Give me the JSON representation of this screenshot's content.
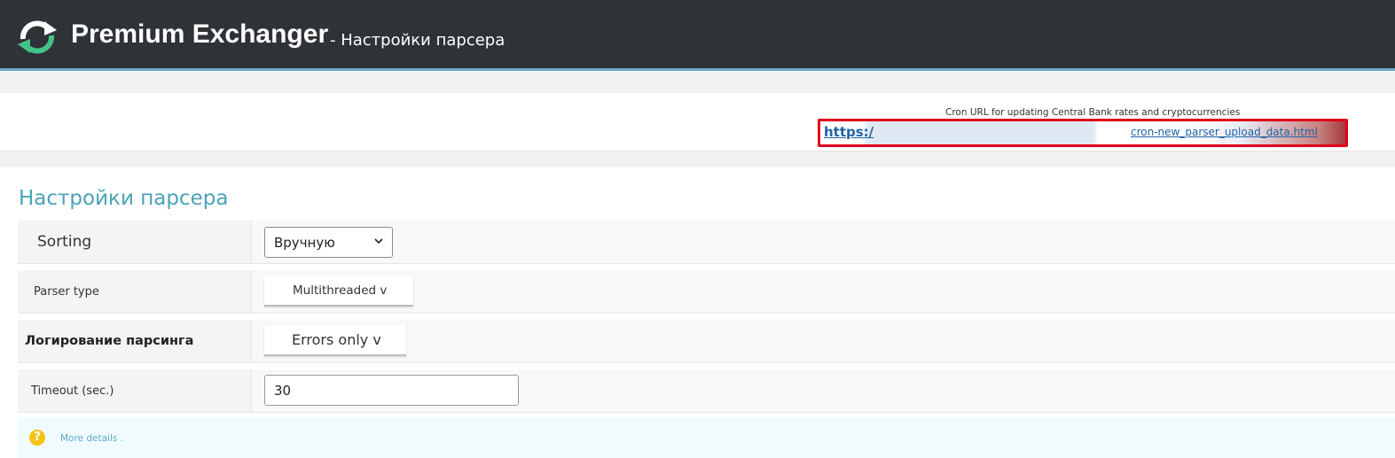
{
  "header": {
    "brand": "Premium Exchanger",
    "subtitle": "- Настройки парсера",
    "logo_icon": "refresh-arrows-logo-icon"
  },
  "cron": {
    "label": "Cron URL for updating Central Bank rates and cryptocurrencies",
    "url_start": "https:/",
    "url_end": "cron-new_parser_upload_data.html"
  },
  "settings": {
    "title": "Настройки парсера",
    "rows": [
      {
        "label": "Sorting",
        "value": "Вручную"
      },
      {
        "label": "Parser type",
        "value": "Multithreaded v"
      },
      {
        "label": "Логирование парсинга",
        "value": "Errors only v"
      },
      {
        "label": "Timeout (sec.)",
        "value": "30"
      }
    ]
  },
  "details": {
    "link": "More details .",
    "icon": "question-icon"
  },
  "colors": {
    "header_bg": "#2f3237",
    "accent": "#4aa3b7",
    "highlight_border": "#e0001b"
  }
}
